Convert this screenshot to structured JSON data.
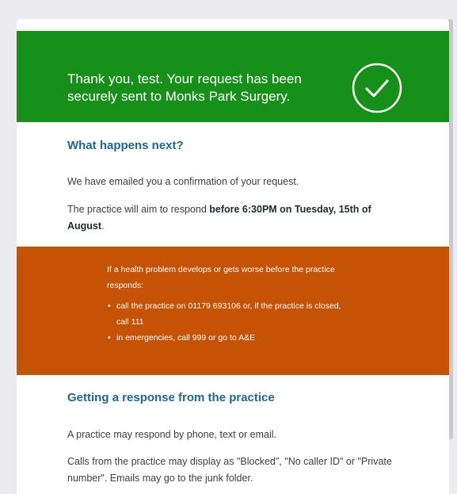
{
  "banner": {
    "message": "Thank you, test. Your request has been securely sent to Monks Park Surgery.",
    "color": "#17901a"
  },
  "next": {
    "heading": "What happens next?",
    "email_confirmation": "We have emailed you a confirmation of your request.",
    "respond_prefix": "The practice will aim to respond ",
    "respond_deadline": "before 6:30PM on Tuesday, 15th of August",
    "respond_suffix": "."
  },
  "warning": {
    "color": "#c55205",
    "intro": "If a health problem develops or gets worse before the practice responds:",
    "items": [
      "call the practice on 01179 693106 or, if the practice is closed, call 111",
      "in emergencies, call 999 or go to A&E"
    ]
  },
  "response": {
    "heading": "Getting a response from the practice",
    "methods": "A practice may respond by phone, text or email.",
    "caller_id_note": "Calls from the practice may display as \"Blocked\", \"No caller ID\" or \"Private number\". Emails may go to the junk folder."
  },
  "icons": {
    "success": "check-circle-icon"
  }
}
